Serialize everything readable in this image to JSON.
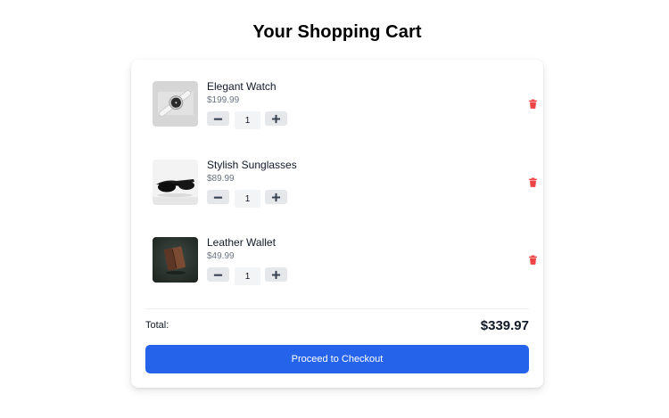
{
  "page": {
    "title": "Your Shopping Cart"
  },
  "cart": {
    "items": [
      {
        "name": "Elegant Watch",
        "price": "$199.99",
        "quantity": "1",
        "image_icon": "watch-image",
        "delete_icon": "trash-icon"
      },
      {
        "name": "Stylish Sunglasses",
        "price": "$89.99",
        "quantity": "1",
        "image_icon": "sunglasses-image",
        "delete_icon": "trash-icon"
      },
      {
        "name": "Leather Wallet",
        "price": "$49.99",
        "quantity": "1",
        "image_icon": "wallet-image",
        "delete_icon": "trash-icon"
      }
    ],
    "total_label": "Total:",
    "total_value": "$339.97",
    "checkout_label": "Proceed to Checkout"
  },
  "colors": {
    "accent": "#2563eb",
    "delete": "#ef4444",
    "qty_button": "#e5e7eb",
    "muted_text": "#6b7280"
  }
}
